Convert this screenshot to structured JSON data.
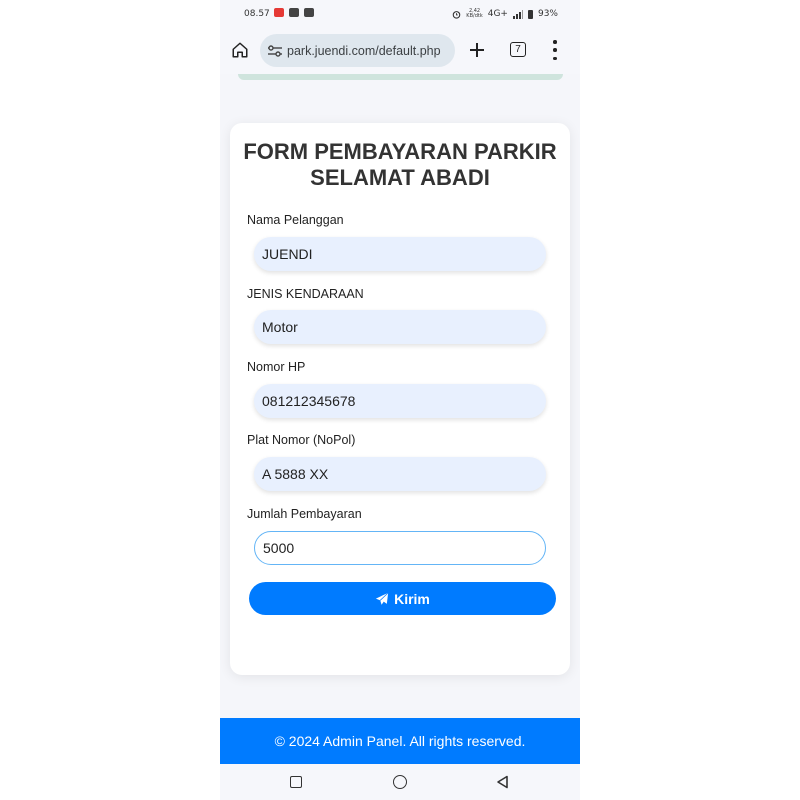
{
  "status_bar": {
    "time": "08.57",
    "network_speed_value": "2,42",
    "network_speed_unit": "KB/dtk",
    "network": "4G+",
    "battery": "93%"
  },
  "browser": {
    "url": "park.juendi.com/default.php",
    "tab_count": "7",
    "icons": [
      "home-icon",
      "site-settings-icon",
      "plus-icon",
      "tabs-icon",
      "more-vert-icon"
    ]
  },
  "form": {
    "title_line1": "FORM PEMBAYARAN PARKIR",
    "title_line2": "SELAMAT ABADI",
    "fields": [
      {
        "label": "Nama Pelanggan",
        "value": "JUENDI"
      },
      {
        "label": "JENIS KENDARAAN",
        "value": "Motor"
      },
      {
        "label": "Nomor HP",
        "value": "081212345678"
      },
      {
        "label": "Plat Nomor (NoPol)",
        "value": "A 5888 XX"
      },
      {
        "label": "Jumlah Pembayaran",
        "value": "5000"
      }
    ],
    "submit_label": "Kirim",
    "submit_icon": "paper-plane-icon"
  },
  "footer": {
    "text": "© 2024 Admin Panel. All rights reserved."
  },
  "colors": {
    "primary": "#007bff",
    "field_bg": "#e8f0fe",
    "focus_border": "#64b5f6"
  }
}
